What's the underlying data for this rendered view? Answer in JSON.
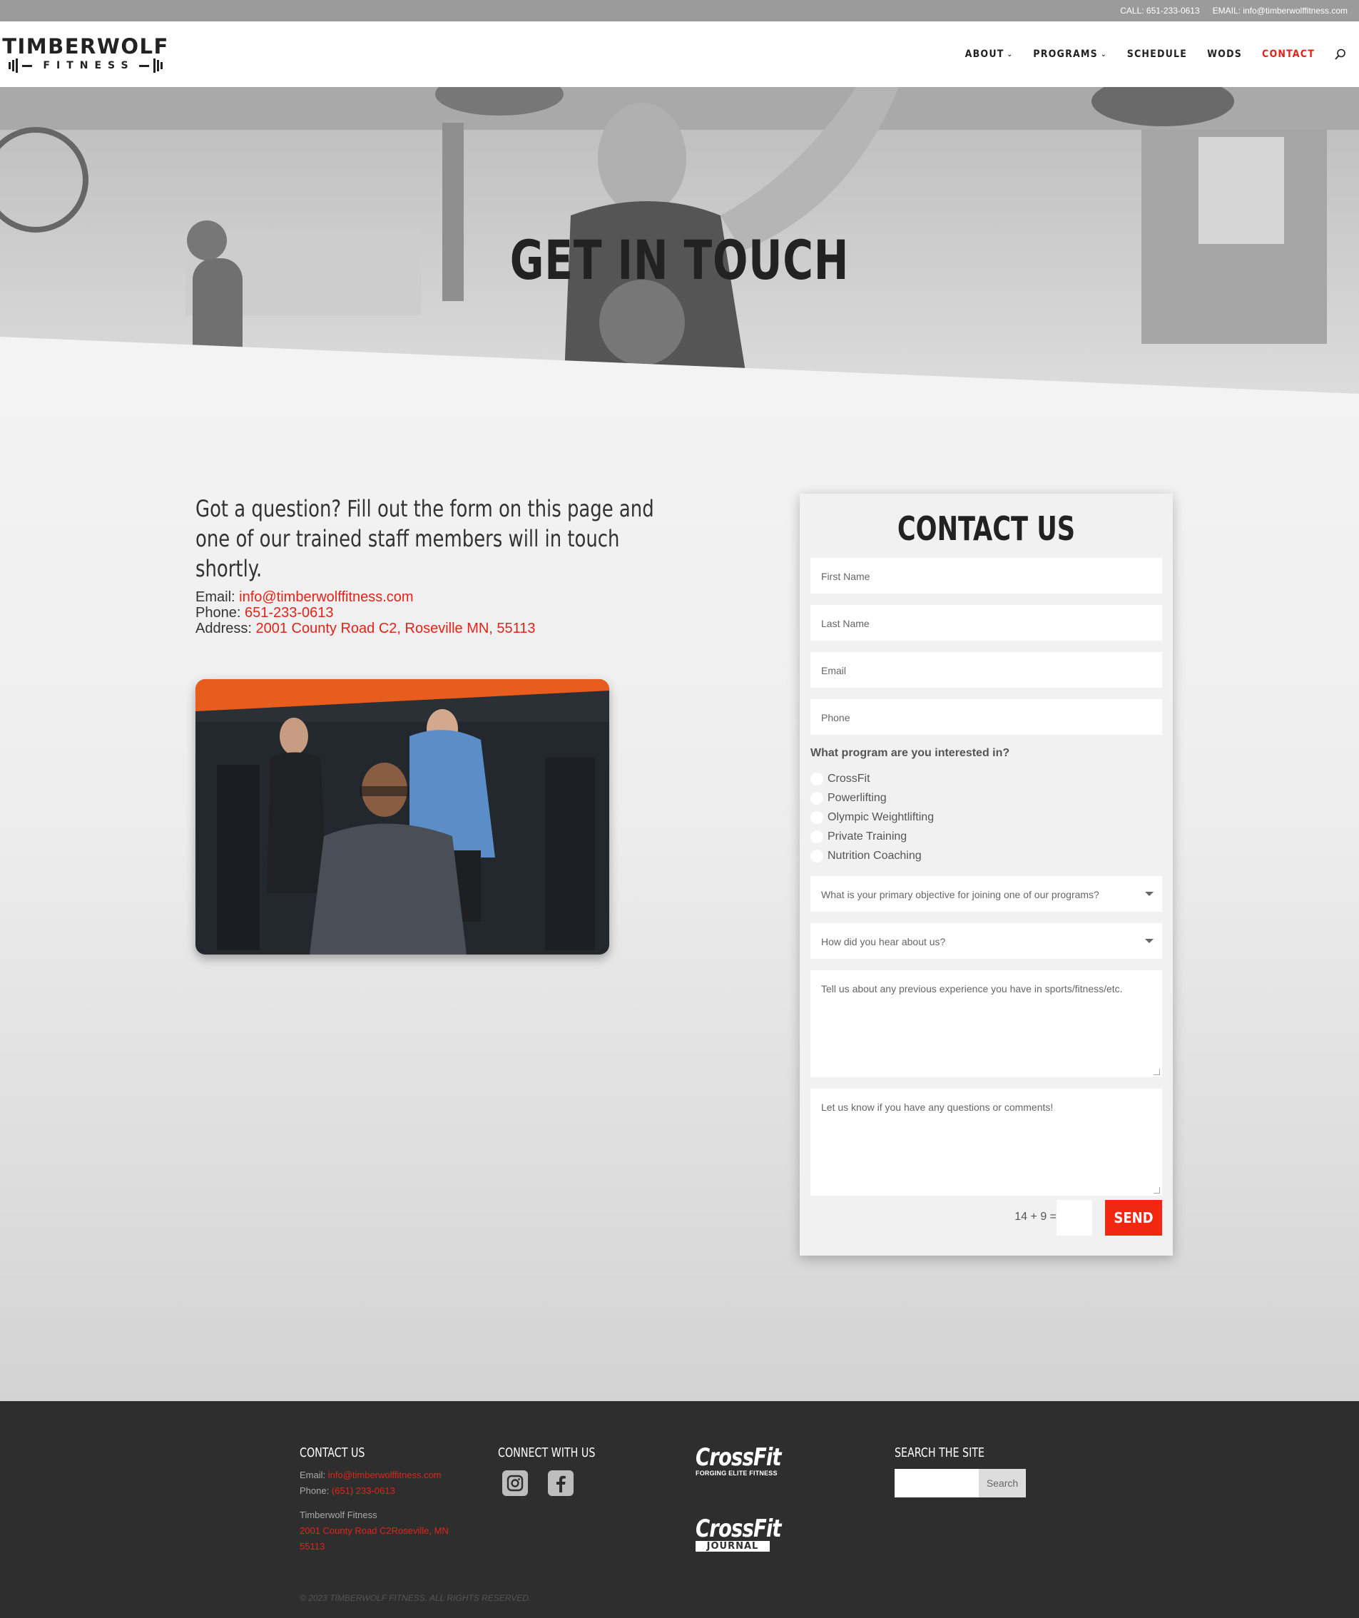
{
  "topbar": {
    "call": "CALL: 651-233-0613",
    "email": "EMAIL: info@timberwolffitness.com"
  },
  "logo": {
    "top": "TIMBERWOLF",
    "bottom": "FITNESS"
  },
  "nav": {
    "items": [
      {
        "label": "ABOUT",
        "dropdown": true
      },
      {
        "label": "PROGRAMS",
        "dropdown": true
      },
      {
        "label": "SCHEDULE"
      },
      {
        "label": "WODS"
      },
      {
        "label": "CONTACT",
        "active": true
      }
    ]
  },
  "hero": {
    "title": "GET IN TOUCH"
  },
  "intro": {
    "lead": "Got a question? Fill out the form on this page and one of our trained staff members will in touch shortly.",
    "email_label": "Email: ",
    "email": "info@timberwolffitness.com",
    "phone_label": "Phone: ",
    "phone": "651-233-0613",
    "address_label": "Address: ",
    "address": "2001 County Road C2, Roseville MN, 55113"
  },
  "form": {
    "title": "CONTACT US",
    "first_name": "First Name",
    "last_name": "Last Name",
    "email": "Email",
    "phone": "Phone",
    "program_question": "What program are you interested in?",
    "programs": [
      "CrossFit",
      "Powerlifting",
      "Olympic Weightlifting",
      "Private Training",
      "Nutrition Coaching"
    ],
    "objective": "What is your primary objective for joining one of our programs?",
    "hear": "How did you hear about us?",
    "experience": "Tell us about any previous experience you have in sports/fitness/etc.",
    "comments": "Let us know if you have any questions or comments!",
    "captcha": "14 + 9 =",
    "send": "SEND"
  },
  "footer": {
    "contact_title": "CONTACT US",
    "email_label": "Email: ",
    "email": "info@timberwolffitness.com",
    "phone_label": "Phone: ",
    "phone": "(651) 233-0613",
    "company": "Timberwolf Fitness",
    "address": "2001 County Road C2Roseville, MN 55113",
    "connect_title": "CONNECT WITH US",
    "crossfit_logo": "CrossFit",
    "crossfit_tag": "FORGING ELITE FITNESS",
    "crossfit_journal_logo": "CrossFit",
    "crossfit_journal_tag": "JOURNAL",
    "search_title": "SEARCH THE SITE",
    "search_button": "Search",
    "copyright": "© 2023 TIMBERWOLF FITNESS. ALL RIGHTS RESERVED."
  },
  "colors": {
    "accent": "#e2231a",
    "send": "#f2270f",
    "footer_bg": "#2e2e2e",
    "topbar_bg": "#9b9b9b"
  },
  "icons": {
    "search": "search-icon",
    "instagram": "instagram-icon",
    "facebook": "facebook-icon"
  }
}
